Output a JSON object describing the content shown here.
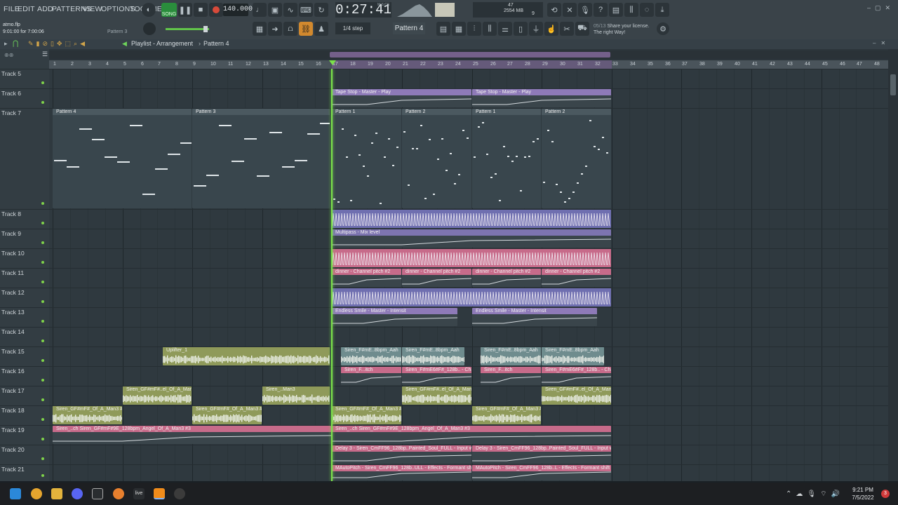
{
  "menu": [
    "FILE",
    "EDIT",
    "ADD",
    "PATTERNS",
    "VIEW",
    "OPTIONS",
    "TOOLS",
    "HELP"
  ],
  "transport": {
    "mode": "SONG",
    "tempo": "140.000",
    "time": "0:27:41",
    "time_unit": "M:S:CS"
  },
  "memory": {
    "value": "2554 MB",
    "cpu": "47",
    "voices": "9"
  },
  "project": {
    "file": "atmo.flp",
    "position": "9:01:00 for 7:00:06",
    "hint": "Pattern 3"
  },
  "snap": "1/4 step",
  "pattern": "Pattern 4",
  "news": {
    "date": "05/13",
    "line1": "Share your license.",
    "line2": "The right Way!"
  },
  "playlist": {
    "title": "Playlist - Arrangement",
    "sep": "›",
    "pattern": "Pattern 4"
  },
  "ruler_labels": [
    "1",
    "2",
    "3",
    "4",
    "5",
    "6",
    "7",
    "8",
    "9",
    "10",
    "11",
    "12",
    "13",
    "14",
    "15",
    "16",
    "17",
    "18",
    "19",
    "20",
    "21",
    "22",
    "23",
    "24",
    "25",
    "26",
    "27",
    "28",
    "29",
    "30",
    "31",
    "32",
    "33",
    "34",
    "35",
    "36",
    "37",
    "38",
    "39",
    "40",
    "41",
    "42",
    "43",
    "44",
    "45",
    "46",
    "47",
    "48"
  ],
  "tracks": [
    "Track 5",
    "Track 6",
    "Track 7",
    "Track 8",
    "Track 9",
    "Track 10",
    "Track 11",
    "Track 12",
    "Track 13",
    "Track 14",
    "Track 15",
    "Track 16",
    "Track 17",
    "Track 18",
    "Track 19",
    "Track 20",
    "Track 21"
  ],
  "clips": [
    {
      "track": 1,
      "start": 17,
      "end": 25,
      "label": "Tape Stop - Master - Play",
      "color": "#8e7ab8",
      "kind": "auto"
    },
    {
      "track": 1,
      "start": 25,
      "end": 33,
      "label": "Tape Stop - Master - Play",
      "color": "#8e7ab8",
      "kind": "auto"
    },
    {
      "track": 2,
      "start": 1,
      "end": 9,
      "label": "Pattern 4",
      "color": "#3d4a51",
      "kind": "pattern"
    },
    {
      "track": 2,
      "start": 9,
      "end": 16.9,
      "label": "Pattern 3",
      "color": "#3d4a51",
      "kind": "pattern"
    },
    {
      "track": 2,
      "start": 17,
      "end": 21,
      "label": "Pattern 1",
      "color": "#3d4a51",
      "kind": "pattern"
    },
    {
      "track": 2,
      "start": 21,
      "end": 25,
      "label": "Pattern 2",
      "color": "#3d4a51",
      "kind": "pattern"
    },
    {
      "track": 2,
      "start": 25,
      "end": 29,
      "label": "Pattern 1",
      "color": "#3d4a51",
      "kind": "pattern"
    },
    {
      "track": 2,
      "start": 29,
      "end": 33,
      "label": "Pattern 2",
      "color": "#3d4a51",
      "kind": "pattern"
    },
    {
      "track": 3,
      "start": 17,
      "end": 33,
      "label": "",
      "color": "#6f6fb0",
      "kind": "wave"
    },
    {
      "track": 4,
      "start": 17,
      "end": 33,
      "label": "Multipass - Mix level",
      "color": "#7d74b0",
      "kind": "auto"
    },
    {
      "track": 5,
      "start": 17,
      "end": 33,
      "label": "",
      "color": "#c76b8a",
      "kind": "wave"
    },
    {
      "track": 6,
      "start": 17,
      "end": 21,
      "label": "dinner - Channel pitch #2",
      "color": "#c76b8a",
      "kind": "auto"
    },
    {
      "track": 6,
      "start": 21,
      "end": 25,
      "label": "dinner - Channel pitch #2",
      "color": "#c76b8a",
      "kind": "auto"
    },
    {
      "track": 6,
      "start": 25,
      "end": 29,
      "label": "dinner - Channel pitch #2",
      "color": "#c76b8a",
      "kind": "auto"
    },
    {
      "track": 6,
      "start": 29,
      "end": 33,
      "label": "dinner - Channel pitch #2",
      "color": "#c76b8a",
      "kind": "auto"
    },
    {
      "track": 7,
      "start": 17,
      "end": 33,
      "label": "",
      "color": "#6f6fb0",
      "kind": "wave"
    },
    {
      "track": 8,
      "start": 17,
      "end": 24.2,
      "label": "Endless Smile - Master - Intensit",
      "color": "#8e7ab8",
      "kind": "auto"
    },
    {
      "track": 8,
      "start": 25,
      "end": 32.2,
      "label": "Endless Smile - Master - Intensit",
      "color": "#8e7ab8",
      "kind": "auto"
    },
    {
      "track": 10,
      "start": 7.3,
      "end": 16.9,
      "label": "Uplifter_1",
      "color": "#8f9a5a",
      "kind": "audio"
    },
    {
      "track": 10,
      "start": 17.5,
      "end": 21,
      "label": "Siren_F#mE..8bpm_Aah",
      "color": "#6f8c8e",
      "kind": "audio"
    },
    {
      "track": 10,
      "start": 21,
      "end": 24.6,
      "label": "Siren_F#mE..8bpm_Aah",
      "color": "#6f8c8e",
      "kind": "audio"
    },
    {
      "track": 10,
      "start": 25.5,
      "end": 29,
      "label": "Siren_F#mE..8bpm_Aah",
      "color": "#6f8c8e",
      "kind": "audio"
    },
    {
      "track": 10,
      "start": 29,
      "end": 32.6,
      "label": "Siren_F#mE..8bpm_Aah",
      "color": "#6f8c8e",
      "kind": "audio"
    },
    {
      "track": 11,
      "start": 17.5,
      "end": 21,
      "label": "Siren_F...itch",
      "color": "#c76b8a",
      "kind": "auto"
    },
    {
      "track": 11,
      "start": 21,
      "end": 25,
      "label": "Siren_F#mE6#F#_128b.. - Channel pitch #2",
      "color": "#c76b8a",
      "kind": "auto"
    },
    {
      "track": 11,
      "start": 25.5,
      "end": 29,
      "label": "Siren_F...itch",
      "color": "#c76b8a",
      "kind": "auto"
    },
    {
      "track": 11,
      "start": 29,
      "end": 33,
      "label": "Siren_F#mE6#F#_128b.. - Channel pitch #2",
      "color": "#c76b8a",
      "kind": "auto"
    },
    {
      "track": 12,
      "start": 5,
      "end": 9,
      "label": "Siren_GF#mF#..el_Of_A_Man3",
      "color": "#8f9a5a",
      "kind": "audio"
    },
    {
      "track": 12,
      "start": 13,
      "end": 16.9,
      "label": "Siren_..Man3",
      "color": "#8f9a5a",
      "kind": "audio"
    },
    {
      "track": 12,
      "start": 21,
      "end": 25,
      "label": "Siren_GF#mF#..el_Of_A_Man3",
      "color": "#8f9a5a",
      "kind": "audio"
    },
    {
      "track": 12,
      "start": 29,
      "end": 33,
      "label": "Siren_GF#mF#..el_Of_A_Man3",
      "color": "#8f9a5a",
      "kind": "audio"
    },
    {
      "track": 13,
      "start": 1,
      "end": 5,
      "label": "Siren_GF#mF#_Of_A_Man3 #2",
      "color": "#8f9a5a",
      "kind": "audio"
    },
    {
      "track": 13,
      "start": 9,
      "end": 13,
      "label": "Siren_GF#mF#_Of_A_Man3 #2",
      "color": "#8f9a5a",
      "kind": "audio"
    },
    {
      "track": 13,
      "start": 17,
      "end": 21,
      "label": "Siren_GF#mF#_Of_A_Man3 #2",
      "color": "#8f9a5a",
      "kind": "audio"
    },
    {
      "track": 13,
      "start": 25,
      "end": 29,
      "label": "Siren_GF#mF#_Of_A_Man3 #2",
      "color": "#8f9a5a",
      "kind": "audio"
    },
    {
      "track": 14,
      "start": 1,
      "end": 17,
      "label": "Siren_..ch  Siren_GF#mF#9E_128bpm_Angel_Of_A_Man3 #3",
      "color": "#c76b8a",
      "kind": "auto"
    },
    {
      "track": 14,
      "start": 17,
      "end": 33,
      "label": "Siren_..ch  Siren_GF#mF#9E_128bpm_Angel_Of_A_Man3 #3",
      "color": "#c76b8a",
      "kind": "auto"
    },
    {
      "track": 15,
      "start": 17,
      "end": 25,
      "label": "Delay 3 - Siren_CmFF96_128bp..Painted_Soul_FULL - Input wet",
      "color": "#c76b8a",
      "kind": "auto"
    },
    {
      "track": 15,
      "start": 25,
      "end": 33,
      "label": "Delay 3 - Siren_CmFF96_128bp..Painted_Soul_FULL - Input wet",
      "color": "#c76b8a",
      "kind": "auto"
    },
    {
      "track": 16,
      "start": 17,
      "end": 25,
      "label": "MAutoPitch - Siren_CmFF96_128b..ULL - Effects - Formant shift",
      "color": "#c76b8a",
      "kind": "auto"
    },
    {
      "track": 16,
      "start": 25,
      "end": 33,
      "label": "MAutoPitch - Siren_CmFF96_128b..L - Effects - Formant shift #2",
      "color": "#c76b8a",
      "kind": "auto"
    }
  ],
  "playhead_bar": 17,
  "clock": {
    "time": "9:21 PM",
    "date": "7/5/2022"
  }
}
